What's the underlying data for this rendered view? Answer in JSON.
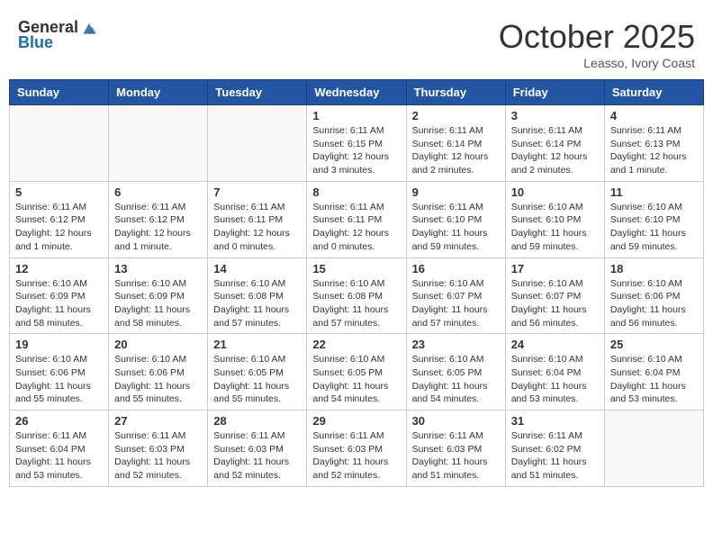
{
  "logo": {
    "general": "General",
    "blue": "Blue"
  },
  "title": "October 2025",
  "location": "Leasso, Ivory Coast",
  "headers": [
    "Sunday",
    "Monday",
    "Tuesday",
    "Wednesday",
    "Thursday",
    "Friday",
    "Saturday"
  ],
  "weeks": [
    [
      {
        "day": "",
        "info": ""
      },
      {
        "day": "",
        "info": ""
      },
      {
        "day": "",
        "info": ""
      },
      {
        "day": "1",
        "info": "Sunrise: 6:11 AM\nSunset: 6:15 PM\nDaylight: 12 hours and 3 minutes."
      },
      {
        "day": "2",
        "info": "Sunrise: 6:11 AM\nSunset: 6:14 PM\nDaylight: 12 hours and 2 minutes."
      },
      {
        "day": "3",
        "info": "Sunrise: 6:11 AM\nSunset: 6:14 PM\nDaylight: 12 hours and 2 minutes."
      },
      {
        "day": "4",
        "info": "Sunrise: 6:11 AM\nSunset: 6:13 PM\nDaylight: 12 hours and 1 minute."
      }
    ],
    [
      {
        "day": "5",
        "info": "Sunrise: 6:11 AM\nSunset: 6:12 PM\nDaylight: 12 hours and 1 minute."
      },
      {
        "day": "6",
        "info": "Sunrise: 6:11 AM\nSunset: 6:12 PM\nDaylight: 12 hours and 1 minute."
      },
      {
        "day": "7",
        "info": "Sunrise: 6:11 AM\nSunset: 6:11 PM\nDaylight: 12 hours and 0 minutes."
      },
      {
        "day": "8",
        "info": "Sunrise: 6:11 AM\nSunset: 6:11 PM\nDaylight: 12 hours and 0 minutes."
      },
      {
        "day": "9",
        "info": "Sunrise: 6:11 AM\nSunset: 6:10 PM\nDaylight: 11 hours and 59 minutes."
      },
      {
        "day": "10",
        "info": "Sunrise: 6:10 AM\nSunset: 6:10 PM\nDaylight: 11 hours and 59 minutes."
      },
      {
        "day": "11",
        "info": "Sunrise: 6:10 AM\nSunset: 6:10 PM\nDaylight: 11 hours and 59 minutes."
      }
    ],
    [
      {
        "day": "12",
        "info": "Sunrise: 6:10 AM\nSunset: 6:09 PM\nDaylight: 11 hours and 58 minutes."
      },
      {
        "day": "13",
        "info": "Sunrise: 6:10 AM\nSunset: 6:09 PM\nDaylight: 11 hours and 58 minutes."
      },
      {
        "day": "14",
        "info": "Sunrise: 6:10 AM\nSunset: 6:08 PM\nDaylight: 11 hours and 57 minutes."
      },
      {
        "day": "15",
        "info": "Sunrise: 6:10 AM\nSunset: 6:08 PM\nDaylight: 11 hours and 57 minutes."
      },
      {
        "day": "16",
        "info": "Sunrise: 6:10 AM\nSunset: 6:07 PM\nDaylight: 11 hours and 57 minutes."
      },
      {
        "day": "17",
        "info": "Sunrise: 6:10 AM\nSunset: 6:07 PM\nDaylight: 11 hours and 56 minutes."
      },
      {
        "day": "18",
        "info": "Sunrise: 6:10 AM\nSunset: 6:06 PM\nDaylight: 11 hours and 56 minutes."
      }
    ],
    [
      {
        "day": "19",
        "info": "Sunrise: 6:10 AM\nSunset: 6:06 PM\nDaylight: 11 hours and 55 minutes."
      },
      {
        "day": "20",
        "info": "Sunrise: 6:10 AM\nSunset: 6:06 PM\nDaylight: 11 hours and 55 minutes."
      },
      {
        "day": "21",
        "info": "Sunrise: 6:10 AM\nSunset: 6:05 PM\nDaylight: 11 hours and 55 minutes."
      },
      {
        "day": "22",
        "info": "Sunrise: 6:10 AM\nSunset: 6:05 PM\nDaylight: 11 hours and 54 minutes."
      },
      {
        "day": "23",
        "info": "Sunrise: 6:10 AM\nSunset: 6:05 PM\nDaylight: 11 hours and 54 minutes."
      },
      {
        "day": "24",
        "info": "Sunrise: 6:10 AM\nSunset: 6:04 PM\nDaylight: 11 hours and 53 minutes."
      },
      {
        "day": "25",
        "info": "Sunrise: 6:10 AM\nSunset: 6:04 PM\nDaylight: 11 hours and 53 minutes."
      }
    ],
    [
      {
        "day": "26",
        "info": "Sunrise: 6:11 AM\nSunset: 6:04 PM\nDaylight: 11 hours and 53 minutes."
      },
      {
        "day": "27",
        "info": "Sunrise: 6:11 AM\nSunset: 6:03 PM\nDaylight: 11 hours and 52 minutes."
      },
      {
        "day": "28",
        "info": "Sunrise: 6:11 AM\nSunset: 6:03 PM\nDaylight: 11 hours and 52 minutes."
      },
      {
        "day": "29",
        "info": "Sunrise: 6:11 AM\nSunset: 6:03 PM\nDaylight: 11 hours and 52 minutes."
      },
      {
        "day": "30",
        "info": "Sunrise: 6:11 AM\nSunset: 6:03 PM\nDaylight: 11 hours and 51 minutes."
      },
      {
        "day": "31",
        "info": "Sunrise: 6:11 AM\nSunset: 6:02 PM\nDaylight: 11 hours and 51 minutes."
      },
      {
        "day": "",
        "info": ""
      }
    ]
  ]
}
